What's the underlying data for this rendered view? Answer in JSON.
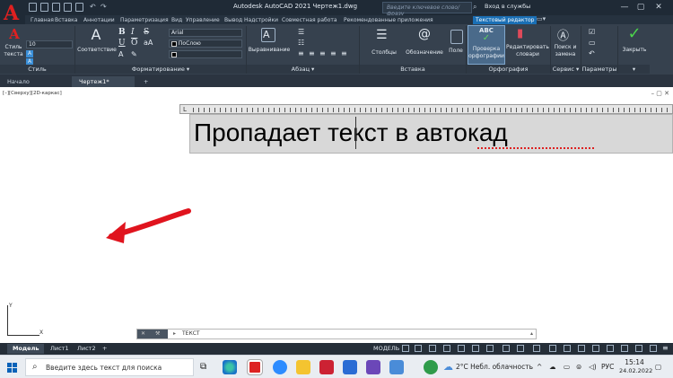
{
  "window": {
    "title": "Autodesk AutoCAD 2021   Чертеж1.dwg",
    "search_placeholder": "Введите ключевое слово/фразу",
    "user_label": "Вход в службы",
    "min": "—",
    "max": "▢",
    "close": "✕"
  },
  "ribbon_tabs": [
    "Главная",
    "Вставка",
    "Аннотации",
    "Параметризация",
    "Вид",
    "Управление",
    "Вывод",
    "Надстройки",
    "Совместная работа",
    "Рекомендованные приложения",
    "Текстовый редактор"
  ],
  "ribbon": {
    "style_label_1": "Стиль",
    "style_label_2": "текста",
    "text_height": "10",
    "annotative_label": "Соответствие",
    "font_name": "Arial",
    "layer_color": "ПоСлою",
    "bold": "B",
    "italic": "I",
    "underline": "U",
    "overline": "O",
    "strike": "S",
    "align_label": "Выравнивание",
    "columns_label": "Столбцы",
    "symbol_label": "Обозначение",
    "field_label": "Поле",
    "spell_check_label_1": "Проверка",
    "spell_check_label_2": "орфографии",
    "edit_dict_label_1": "Редактировать",
    "edit_dict_label_2": "словари",
    "find_label_1": "Поиск и",
    "find_label_2": "замена",
    "close_label": "Закрыть",
    "panels": {
      "style": "Стиль",
      "formatting": "Форматирование ▾",
      "paragraph": "Абзац ▾",
      "insert": "Вставка",
      "spelling": "Орфография",
      "tools": "Сервис ▾",
      "params": "Параметры",
      "close_panel": "▾"
    }
  },
  "file_tabs": [
    "Начало",
    "Чертеж1*",
    "+"
  ],
  "viewport": {
    "label": "[–][Сверху][2D-каркас]",
    "controls": "–  ▢  ✕"
  },
  "editor": {
    "text": "Пропадает текст в автокад"
  },
  "ucs": {
    "x": "X",
    "y": "Y"
  },
  "command_line": {
    "text": "ТЕКСТ"
  },
  "layout_tabs": [
    "Модель",
    "Лист1",
    "Лист2",
    "+"
  ],
  "status": {
    "model": "МОДЕЛЬ"
  },
  "taskbar": {
    "search_placeholder": "Введите здесь текст для поиска",
    "weather": "2°C  Небл. облачность",
    "lang": "РУС",
    "time": "15:14",
    "date": "24.02.2022"
  },
  "colors": {
    "accent": "#1a6fb5",
    "autocad_red": "#e02020",
    "arrow_red": "#e0141e"
  }
}
